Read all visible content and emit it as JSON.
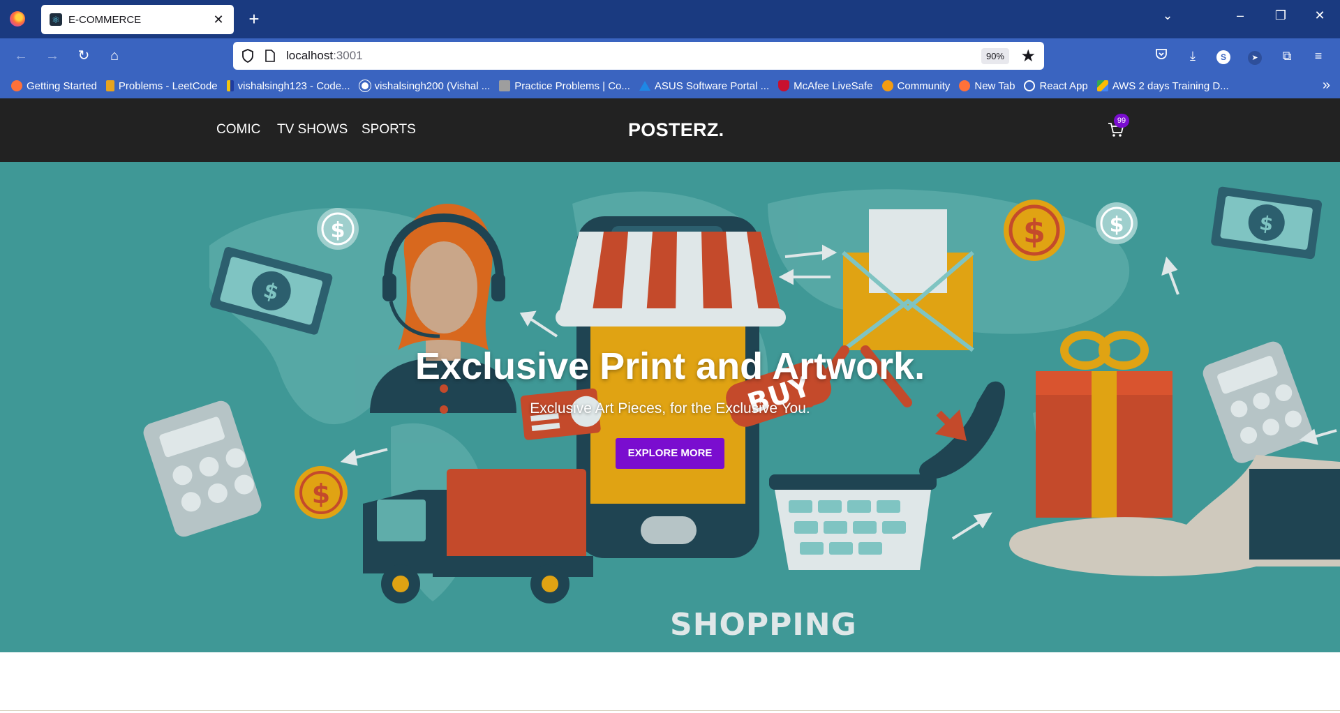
{
  "browser": {
    "tab": {
      "title": "E-COMMERCE",
      "favicon": "react-icon"
    },
    "url": {
      "host": "localhost",
      "port": ":3001"
    },
    "zoom": "90%",
    "bookmarks": [
      {
        "label": "Getting Started",
        "icon": "firefox-icon",
        "color": "#ff7139"
      },
      {
        "label": "Problems - LeetCode",
        "icon": "leetcode-icon",
        "color": "#e7a41f"
      },
      {
        "label": "vishalsingh123 - Code...",
        "icon": "codechef-icon",
        "color": "#f1c40f"
      },
      {
        "label": "vishalsingh200 (Vishal ...",
        "icon": "github-icon",
        "color": "#ffffff"
      },
      {
        "label": "Practice Problems | Co...",
        "icon": "codingninjas-icon",
        "color": "#9e9e9e"
      },
      {
        "label": "ASUS Software Portal ...",
        "icon": "asus-icon",
        "color": "#1e88e5"
      },
      {
        "label": "McAfee LiveSafe",
        "icon": "mcafee-icon",
        "color": "#c8102e"
      },
      {
        "label": "Community",
        "icon": "community-icon",
        "color": "#f39c12"
      },
      {
        "label": "New Tab",
        "icon": "firefox-icon",
        "color": "#ff7139"
      },
      {
        "label": "React App",
        "icon": "globe-icon",
        "color": "#ffffff"
      },
      {
        "label": "AWS 2 days Training D...",
        "icon": "drive-icon",
        "color": "#34a853"
      }
    ]
  },
  "site": {
    "nav": [
      "COMIC",
      "TV SHOWS",
      "SPORTS"
    ],
    "brand": "POSTERZ.",
    "cart_count": "99",
    "accent": "#7a0dcf"
  },
  "hero": {
    "title": "Exclusive Print and Artwork.",
    "subtitle": "Exclusive Art Pieces, for the Exclusive You.",
    "cta": "EXPLORE MORE",
    "bg_label": "SHOPPING",
    "bg_color": "#3f9896"
  }
}
